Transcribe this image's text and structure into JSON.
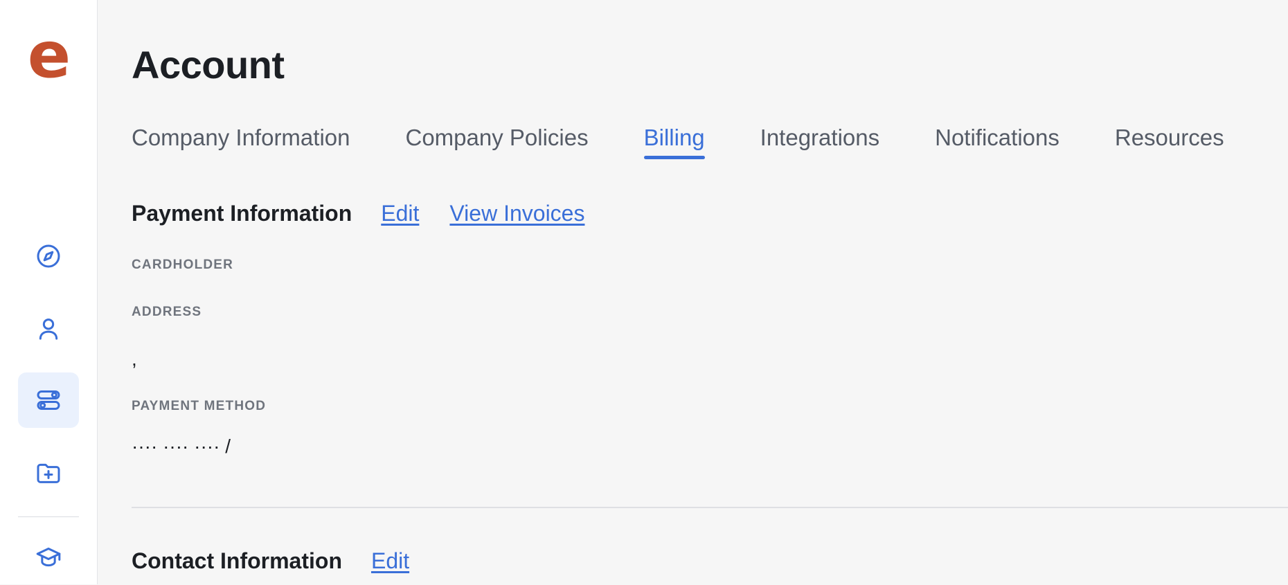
{
  "brand": {
    "logo_text": "e",
    "color": "#c4502e"
  },
  "sidebar": {
    "items": [
      {
        "name": "explore",
        "icon": "compass-icon",
        "active": false
      },
      {
        "name": "people",
        "icon": "user-icon",
        "active": false
      },
      {
        "name": "settings",
        "icon": "toggles-icon",
        "active": true
      },
      {
        "name": "files",
        "icon": "folder-plus-icon",
        "active": false
      },
      {
        "name": "learning",
        "icon": "graduation-cap-icon",
        "active": false
      }
    ],
    "icon_color": "#3a6fd8",
    "active_bg": "#eaf1fd"
  },
  "page": {
    "title": "Account"
  },
  "tabs": [
    {
      "label": "Company Information",
      "active": false
    },
    {
      "label": "Company Policies",
      "active": false
    },
    {
      "label": "Billing",
      "active": true
    },
    {
      "label": "Integrations",
      "active": false
    },
    {
      "label": "Notifications",
      "active": false
    },
    {
      "label": "Resources",
      "active": false
    }
  ],
  "payment": {
    "title": "Payment Information",
    "edit_label": "Edit",
    "invoices_label": "View Invoices",
    "cardholder_label": "CARDHOLDER",
    "cardholder_value": "",
    "address_label": "ADDRESS",
    "address_value": ",",
    "method_label": "PAYMENT METHOD",
    "method_value": "···· ···· ···· /"
  },
  "contact": {
    "title": "Contact Information",
    "edit_label": "Edit"
  },
  "colors": {
    "accent": "#3a6fd8",
    "background": "#f6f6f6",
    "text": "#1c1f24",
    "muted": "#6f747d"
  }
}
